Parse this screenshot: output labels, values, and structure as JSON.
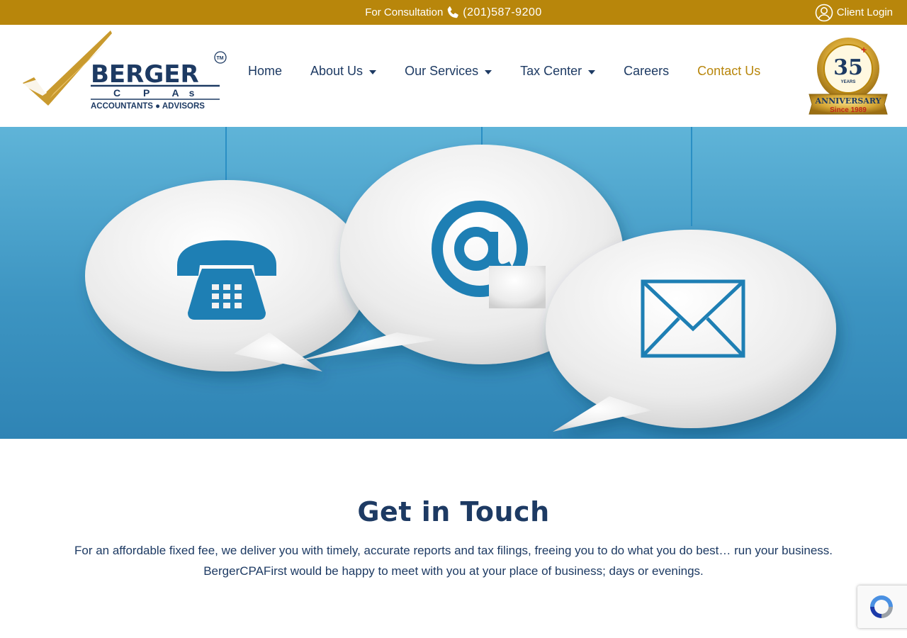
{
  "topbar": {
    "consult_label": "For Consultation",
    "phone": "(201)587-9200",
    "login_label": "Client Login"
  },
  "logo": {
    "brand": "BERGER",
    "sub": "C P As",
    "tagline": "ACCOUNTANTS ● ADVISORS",
    "tm": "TM"
  },
  "nav": {
    "items": [
      {
        "label": "Home",
        "dropdown": false,
        "active": false
      },
      {
        "label": "About Us",
        "dropdown": true,
        "active": false
      },
      {
        "label": "Our Services",
        "dropdown": true,
        "active": false
      },
      {
        "label": "Tax Center",
        "dropdown": true,
        "active": false
      },
      {
        "label": "Careers",
        "dropdown": false,
        "active": false
      },
      {
        "label": "Contact Us",
        "dropdown": false,
        "active": true
      }
    ]
  },
  "badge": {
    "years": "35",
    "years_label": "YEARS",
    "ribbon": "ANNIVERSARY",
    "since": "Since 1989"
  },
  "hero": {
    "icons": [
      "telephone-icon",
      "at-sign-icon",
      "envelope-icon"
    ]
  },
  "content": {
    "title": "Get in Touch",
    "paragraph": "For an affordable fixed fee, we deliver you with timely, accurate reports and tax filings, freeing you to do what you do best… run your business. BergerCPAFirst would be happy to meet with you at your place of business; days or evenings."
  },
  "colors": {
    "gold": "#b8860b",
    "navy": "#1d3a63",
    "sky": "#4aa3cf"
  }
}
